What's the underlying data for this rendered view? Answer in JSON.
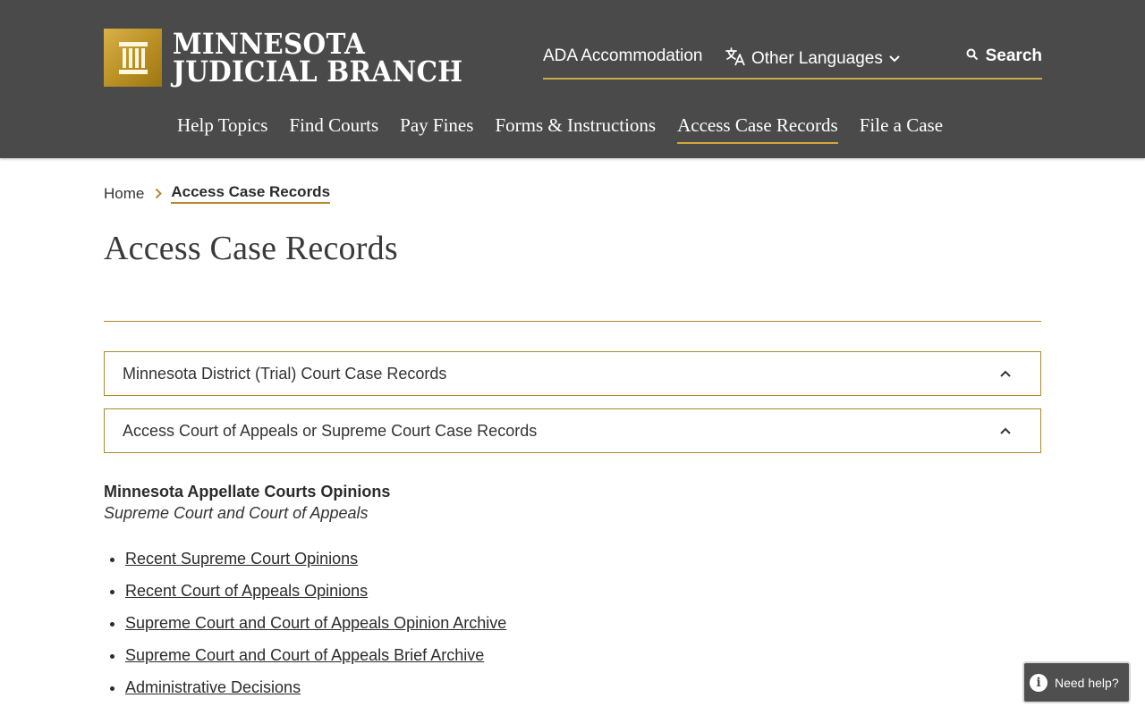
{
  "header": {
    "logo_line1": "MINNESOTA",
    "logo_line2": "JUDICIAL BRANCH",
    "utility": {
      "ada": "ADA Accommodation",
      "languages": "Other Languages",
      "search": "Search"
    },
    "nav": [
      {
        "label": "Help Topics"
      },
      {
        "label": "Find Courts"
      },
      {
        "label": "Pay Fines"
      },
      {
        "label": "Forms & Instructions"
      },
      {
        "label": "Access Case Records",
        "active": true
      },
      {
        "label": "File a Case"
      }
    ]
  },
  "breadcrumb": {
    "home": "Home",
    "current": "Access Case Records"
  },
  "page_title": "Access Case Records",
  "accordions": [
    {
      "label": "Minnesota District (Trial) Court Case Records"
    },
    {
      "label": "Access Court of Appeals or Supreme Court Case Records"
    }
  ],
  "opinions": {
    "title": "Minnesota Appellate Courts Opinions",
    "subtitle": "Supreme Court and Court of Appeals",
    "links": [
      "Recent Supreme Court Opinions",
      "Recent Court of Appeals Opinions",
      "Supreme Court and Court of Appeals Opinion Archive",
      "Supreme Court and Court of Appeals Brief Archive",
      "Administrative Decisions"
    ]
  },
  "help_widget": {
    "label": "Need help?",
    "icon": "info-icon"
  },
  "colors": {
    "header_bg": "#4a4a4a",
    "accent_gold": "#a88a2c",
    "nav_underline": "#d4a83a"
  }
}
